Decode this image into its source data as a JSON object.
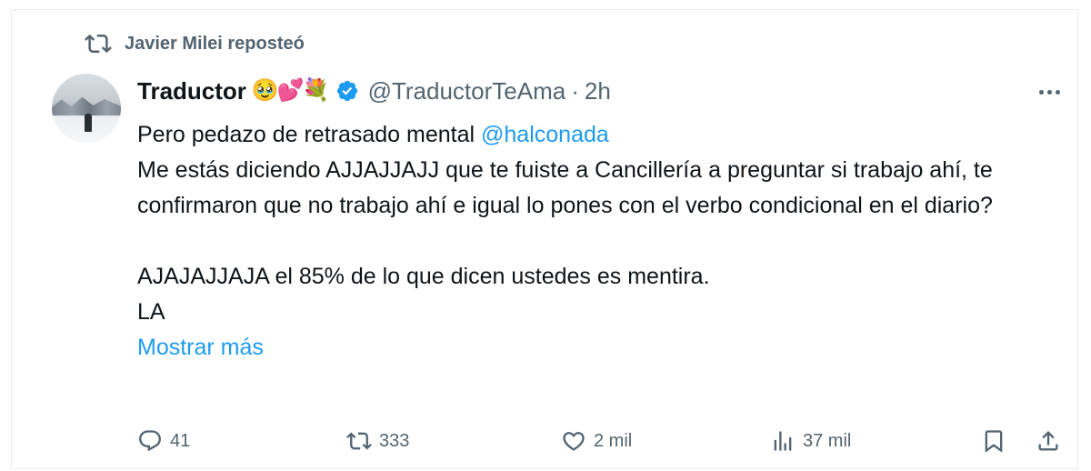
{
  "repost": {
    "icon": "repost-icon",
    "text": "Javier Milei reposteó"
  },
  "tweet": {
    "author_name": "Traductor",
    "author_emojis": "🥹💕💐",
    "handle": "@TraductorTeAma",
    "separator": "·",
    "time": "2h",
    "verified": true,
    "body": {
      "line1_text": "Pero pedazo de retrasado mental ",
      "line1_mention": "@halconada",
      "paragraph1": "Me estás diciendo AJJAJJAJJ que te fuiste a Cancillería a preguntar si trabajo ahí, te confirmaron que no trabajo ahí e igual lo pones con el verbo condicional en el diario?",
      "paragraph2": "AJAJAJJAJA el 85% de lo que dicen ustedes es mentira.",
      "paragraph3": "LA",
      "show_more": "Mostrar más"
    }
  },
  "actions": {
    "replies": "41",
    "reposts": "333",
    "likes": "2 mil",
    "views": "37 mil"
  },
  "colors": {
    "text": "#0f1419",
    "secondary": "#536471",
    "accent": "#1d9bf0"
  }
}
